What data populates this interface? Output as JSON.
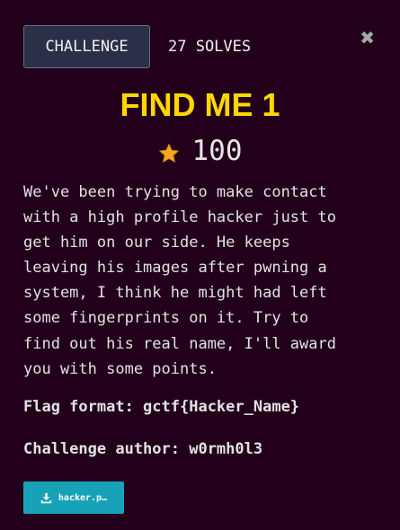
{
  "tabs": {
    "challenge_label": "CHALLENGE",
    "solves_label": "27 SOLVES"
  },
  "close_label": "✖",
  "challenge": {
    "title": "FIND ME 1",
    "points": "100",
    "description": "We've been trying to make contact\nwith a high profile hacker just to\nget him on our side. He keeps\nleaving his images after pwning a\nsystem, I think he might had left\nsome fingerprints on it. Try to\nfind out his real name, I'll award\nyou with some points.",
    "flag_format": "Flag format: gctf{Hacker_Name}",
    "author": "Challenge author: w0rmh0l3",
    "file_label": "hacker.p…"
  },
  "colors": {
    "background": "#22001c",
    "title": "#ffd700",
    "tab_bg": "#2c2f48",
    "download_bg": "#17a2b8",
    "star": "#f5a623"
  },
  "icons": {
    "points": "star-icon",
    "download": "download-icon",
    "close": "close-icon"
  }
}
